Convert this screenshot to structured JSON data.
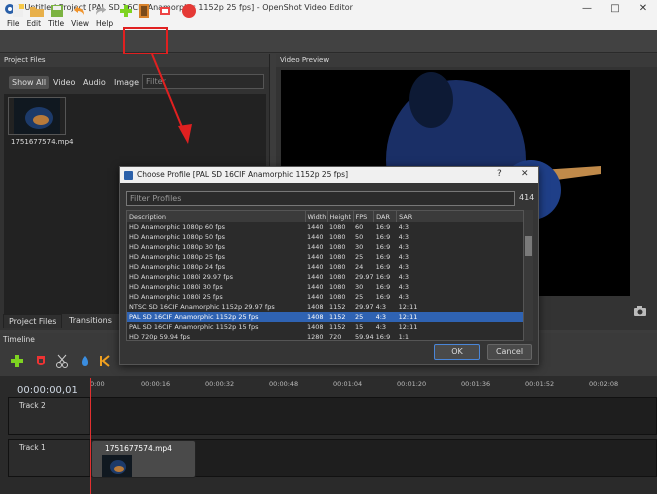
{
  "window": {
    "title": "* Untitled Project [PAL SD 16CIF Anamorphic 1152p 25 fps] - OpenShot Video Editor",
    "controls": [
      "—",
      "□",
      "✕"
    ]
  },
  "menu": [
    "File",
    "Edit",
    "Title",
    "View",
    "Help"
  ],
  "project_files": {
    "header": "Project Files",
    "filters": [
      "Show All",
      "Video",
      "Audio",
      "Image"
    ],
    "filter_placeholder": "Filter",
    "file_name": "1751677574.mp4",
    "bottom_tabs": [
      "Project Files",
      "Transitions"
    ]
  },
  "video_preview": {
    "header": "Video Preview"
  },
  "timeline": {
    "header": "Timeline",
    "timecode": "00:00:00,01",
    "ticks": [
      "0:00",
      "00:00:16",
      "00:00:32",
      "00:00:48",
      "00:01:04",
      "00:01:20",
      "00:01:36",
      "00:01:52",
      "00:02:08"
    ],
    "tracks": [
      "Track 2",
      "Track 1"
    ],
    "clip_name": "1751677574.mp4"
  },
  "dialog": {
    "title": "Choose Profile [PAL SD 16CIF Anamorphic 1152p 25 fps]",
    "help": "?",
    "close": "✕",
    "filter_placeholder": "Filter Profiles",
    "count": "414",
    "columns": [
      "Description",
      "Width",
      "Height",
      "FPS",
      "DAR",
      "SAR"
    ],
    "rows": [
      [
        "HD Anamorphic 1080p 60 fps",
        "1440",
        "1080",
        "60",
        "16:9",
        "4:3"
      ],
      [
        "HD Anamorphic 1080p 50 fps",
        "1440",
        "1080",
        "50",
        "16:9",
        "4:3"
      ],
      [
        "HD Anamorphic 1080p 30 fps",
        "1440",
        "1080",
        "30",
        "16:9",
        "4:3"
      ],
      [
        "HD Anamorphic 1080p 25 fps",
        "1440",
        "1080",
        "25",
        "16:9",
        "4:3"
      ],
      [
        "HD Anamorphic 1080p 24 fps",
        "1440",
        "1080",
        "24",
        "16:9",
        "4:3"
      ],
      [
        "HD Anamorphic 1080i 29.97 fps",
        "1440",
        "1080",
        "29.97",
        "16:9",
        "4:3"
      ],
      [
        "HD Anamorphic 1080i 30 fps",
        "1440",
        "1080",
        "30",
        "16:9",
        "4:3"
      ],
      [
        "HD Anamorphic 1080i 25 fps",
        "1440",
        "1080",
        "25",
        "16:9",
        "4:3"
      ],
      [
        "NTSC SD 16CIF Anamorphic 1152p 29.97 fps",
        "1408",
        "1152",
        "29.97",
        "4:3",
        "12:11"
      ],
      [
        "PAL SD 16CIF Anamorphic 1152p 25 fps",
        "1408",
        "1152",
        "25",
        "4:3",
        "12:11"
      ],
      [
        "PAL SD 16CIF Anamorphic 1152p 15 fps",
        "1408",
        "1152",
        "15",
        "4:3",
        "12:11"
      ],
      [
        "HD 720p 59.94 fps",
        "1280",
        "720",
        "59.94",
        "16:9",
        "1:1"
      ]
    ],
    "selected_row": 9,
    "ok": "OK",
    "cancel": "Cancel"
  }
}
